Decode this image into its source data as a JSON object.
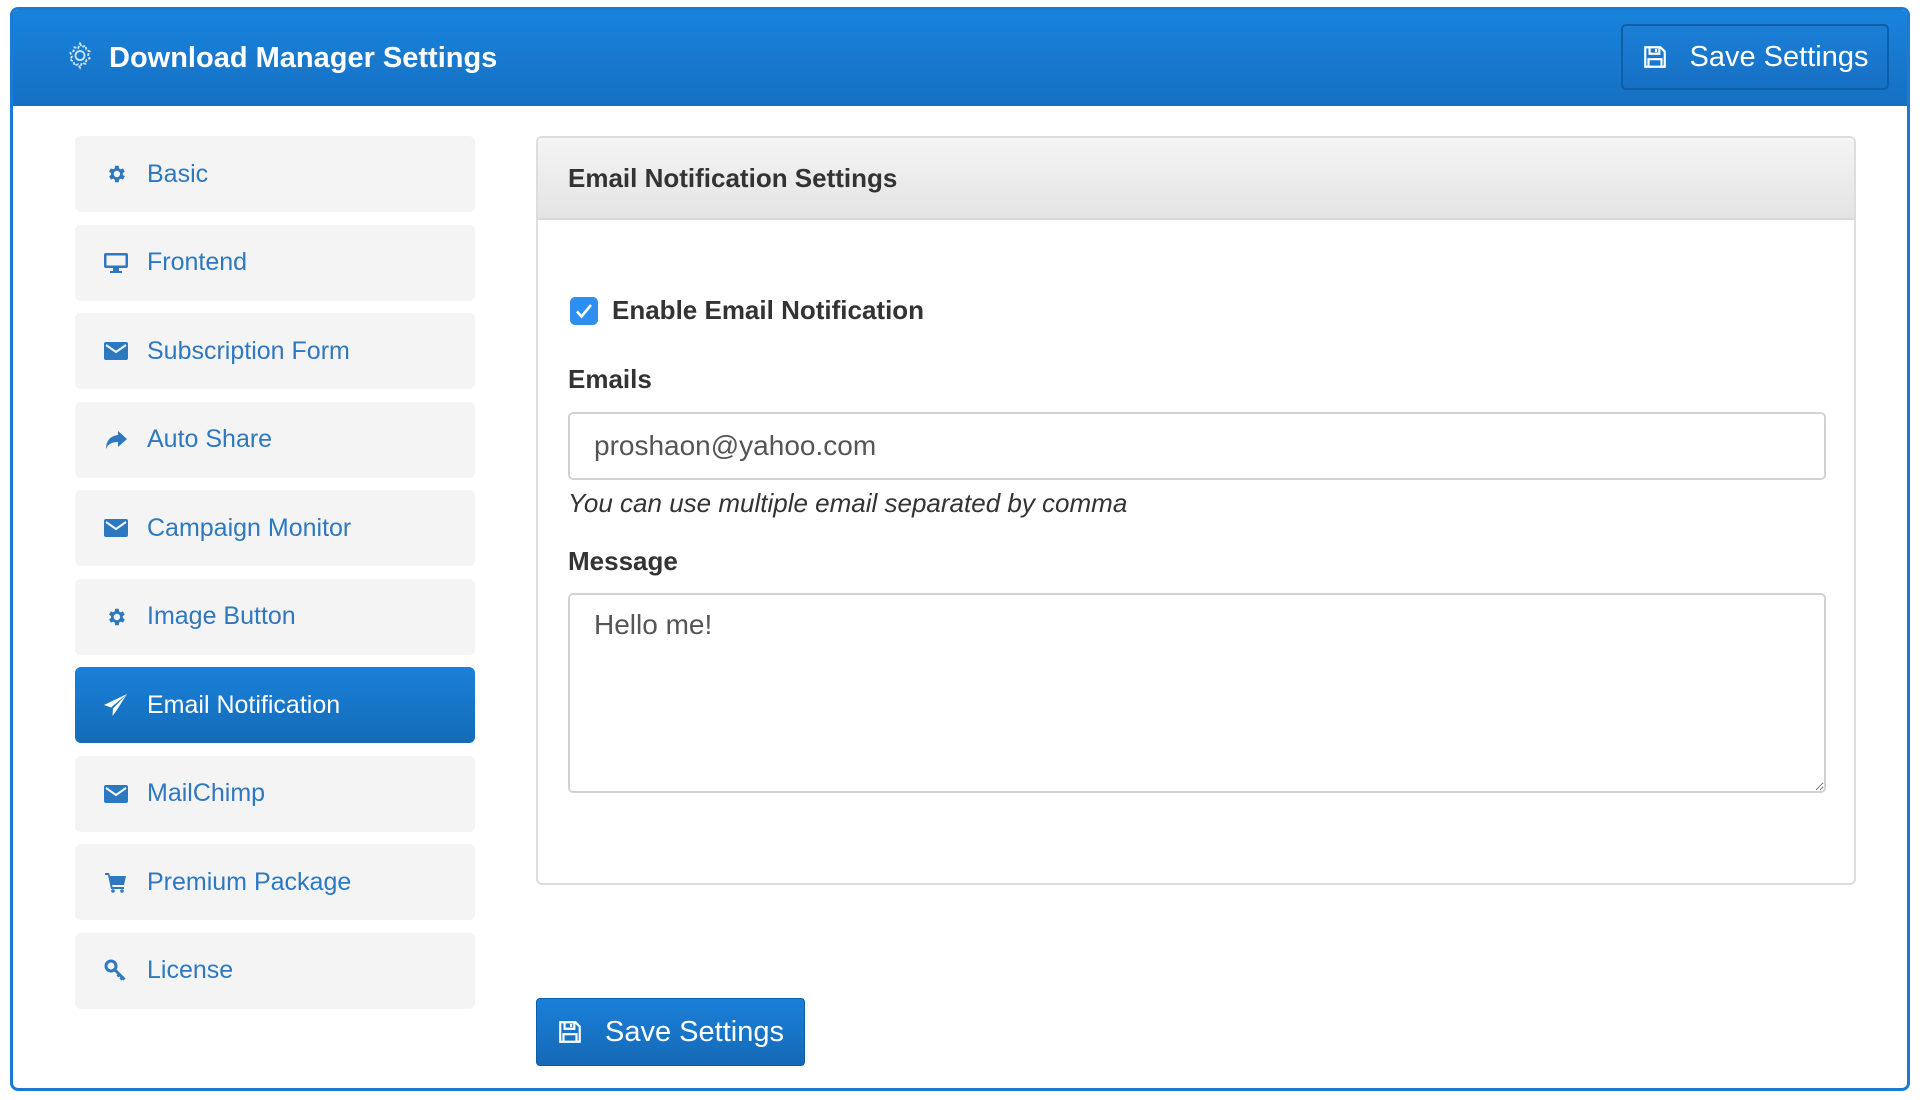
{
  "header": {
    "title": "Download Manager Settings",
    "icon": "gear-icon",
    "save_label": "Save Settings"
  },
  "sidebar": {
    "items": [
      {
        "label": "Basic",
        "icon": "gear-icon",
        "active": false
      },
      {
        "label": "Frontend",
        "icon": "desktop-icon",
        "active": false
      },
      {
        "label": "Subscription Form",
        "icon": "envelope-icon",
        "active": false
      },
      {
        "label": "Auto Share",
        "icon": "share-icon",
        "active": false
      },
      {
        "label": "Campaign Monitor",
        "icon": "envelope-icon",
        "active": false
      },
      {
        "label": "Image Button",
        "icon": "gear-icon",
        "active": false
      },
      {
        "label": "Email Notification",
        "icon": "paper-plane-icon",
        "active": true
      },
      {
        "label": "MailChimp",
        "icon": "envelope-icon",
        "active": false
      },
      {
        "label": "Premium Package",
        "icon": "cart-icon",
        "active": false
      },
      {
        "label": "License",
        "icon": "key-icon",
        "active": false
      }
    ]
  },
  "panel": {
    "title": "Email Notification Settings",
    "enable_label": "Enable Email Notification",
    "enable_checked": true,
    "emails_label": "Emails",
    "emails_value": "proshaon@yahoo.com",
    "emails_hint": "You can use multiple email separated by comma",
    "message_label": "Message",
    "message_value": "Hello me!"
  },
  "footer": {
    "save_label": "Save Settings"
  },
  "colors": {
    "accent": "#1a7ad6",
    "nav_text": "#2e78bf",
    "nav_bg": "#f4f4f4",
    "checkbox": "#2e8ff0"
  }
}
